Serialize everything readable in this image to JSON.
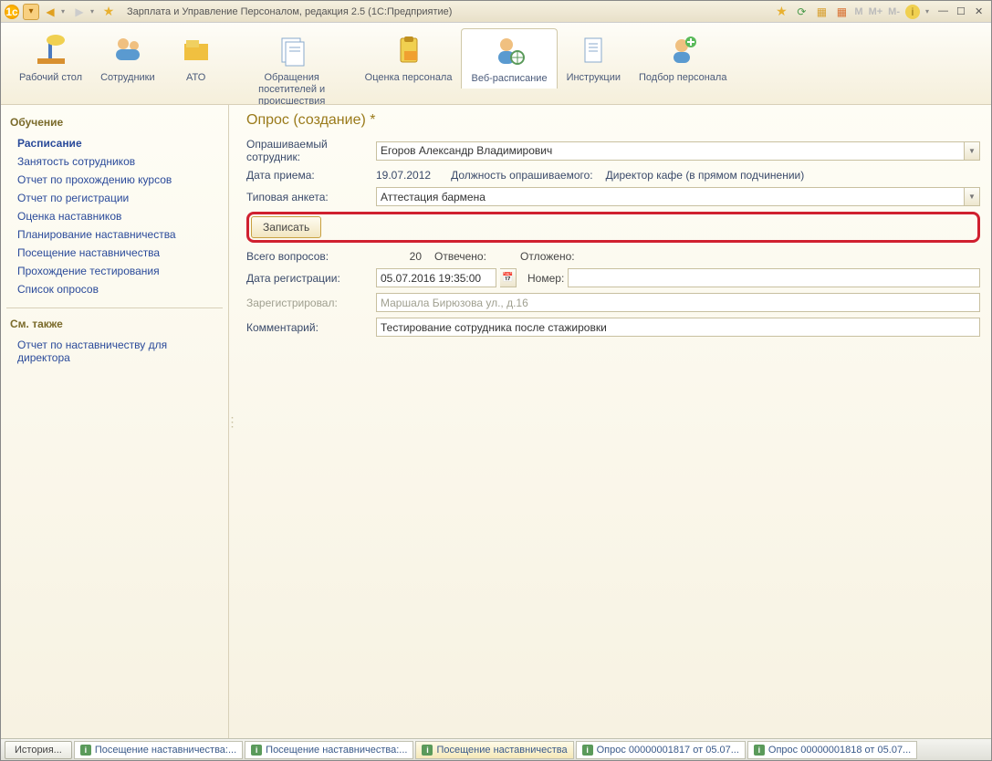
{
  "titlebar": {
    "title": "Зарплата и Управление Персоналом, редакция 2.5  (1С:Предприятие)",
    "m_labels": [
      "M",
      "M+",
      "M-"
    ]
  },
  "toolbar": {
    "items": [
      {
        "label": "Рабочий стол"
      },
      {
        "label": "Сотрудники"
      },
      {
        "label": "АТО"
      },
      {
        "label": "Обращения посетителей и происшествия"
      },
      {
        "label": "Оценка персонала"
      },
      {
        "label": "Веб-расписание"
      },
      {
        "label": "Инструкции"
      },
      {
        "label": "Подбор персонала"
      }
    ]
  },
  "sidebar": {
    "group1_title": "Обучение",
    "group1": [
      "Расписание",
      "Занятость сотрудников",
      "Отчет по прохождению курсов",
      "Отчет по регистрации",
      "Оценка наставников",
      "Планирование наставничества",
      "Посещение наставничества",
      "Прохождение тестирования",
      "Список опросов"
    ],
    "group2_title": "См. также",
    "group2": [
      "Отчет по наставничеству для директора"
    ]
  },
  "form": {
    "title": "Опрос (создание) *",
    "labels": {
      "employee": "Опрашиваемый сотрудник:",
      "hire_date": "Дата приема:",
      "position": "Должность опрашиваемого:",
      "template": "Типовая анкета:",
      "save": "Записать",
      "total_q": "Всего вопросов:",
      "answered": "Отвечено:",
      "postponed": "Отложено:",
      "reg_date": "Дата регистрации:",
      "number": "Номер:",
      "registered_by": "Зарегистрировал:",
      "comment": "Комментарий:"
    },
    "values": {
      "employee": "Егоров Александр Владимирович",
      "hire_date": "19.07.2012",
      "position": "Директор кафе (в прямом подчинении)",
      "template": "Аттестация бармена",
      "total_q": "20",
      "answered": "",
      "postponed": "",
      "reg_date": "05.07.2016 19:35:00",
      "number": "",
      "registered_by": "Маршала Бирюзова ул., д.16",
      "comment": "Тестирование сотрудника после стажировки"
    }
  },
  "statusbar": {
    "history": "История...",
    "tabs": [
      "Посещение наставничества:...",
      "Посещение наставничества:...",
      "Посещение наставничества",
      "Опрос 00000001817 от 05.07...",
      "Опрос 00000001818 от 05.07..."
    ]
  }
}
